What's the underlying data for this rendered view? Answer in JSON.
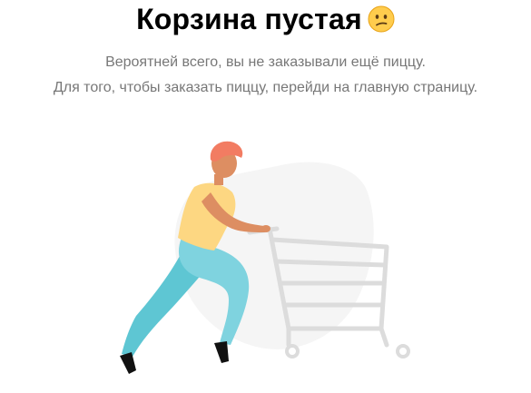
{
  "empty_cart": {
    "title": "Корзина пустая",
    "emoji_icon": "confused-face-icon",
    "subtitle_line1": "Вероятней всего, вы не заказывали ещё пиццу.",
    "subtitle_line2": "Для того, чтобы заказать пиццу, перейди на главную страницу."
  },
  "illustration": {
    "subject": "person-pushing-shopping-cart",
    "colors": {
      "blob": "#f5f5f5",
      "cart": "#dcdcdc",
      "shirt": "#fdd782",
      "pants": "#7fd3df",
      "pants_shade": "#5ec6d3",
      "skin": "#dd8e62",
      "hair": "#f27c62",
      "shoes": "#111111"
    }
  }
}
